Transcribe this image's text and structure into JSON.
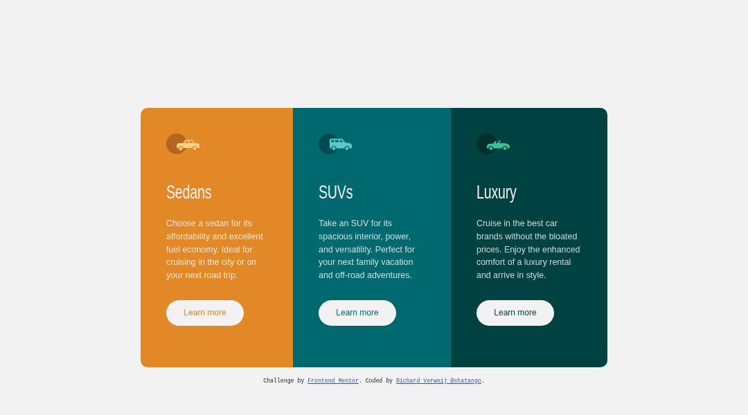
{
  "cards": [
    {
      "kind": "sedan",
      "color": "#e38826",
      "title": "Sedans",
      "description": "Choose a sedan for its affordability and excellent fuel economy. Ideal for cruising in the city or on your next road trip.",
      "button": "Learn more"
    },
    {
      "kind": "suv",
      "color": "#006970",
      "title": "SUVs",
      "description": "Take an SUV for its spacious interior, power, and versatility. Perfect for your next family vacation and off-road adventures.",
      "button": "Learn more"
    },
    {
      "kind": "luxury",
      "color": "#004241",
      "title": "Luxury",
      "description": "Cruise in the best car brands without the bloated prices. Enjoy the enhanced comfort of a luxury rental and arrive in style.",
      "button": "Learn more"
    }
  ],
  "footer": {
    "segments": [
      {
        "kind": "text",
        "text": "Challenge by "
      },
      {
        "kind": "link",
        "text": "Frontend Mentor"
      },
      {
        "kind": "text",
        "text": ". Coded by "
      },
      {
        "kind": "link",
        "text": "Richard Verweij @shatango"
      },
      {
        "kind": "text",
        "text": "."
      }
    ]
  }
}
